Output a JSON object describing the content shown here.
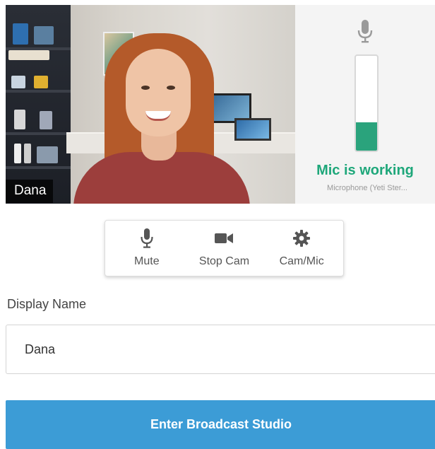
{
  "camera": {
    "name_tag": "Dana"
  },
  "mic": {
    "status": "Mic is working",
    "device": "Microphone (Yeti Ster...",
    "level": 0.3,
    "status_color": "#1ea77a"
  },
  "controls": [
    {
      "label": "Mute",
      "icon": "microphone-icon"
    },
    {
      "label": "Stop Cam",
      "icon": "video-camera-icon"
    },
    {
      "label": "Cam/Mic",
      "icon": "gear-icon"
    }
  ],
  "form": {
    "display_name_label": "Display Name",
    "display_name_value": "Dana"
  },
  "enter_button": {
    "label": "Enter Broadcast Studio",
    "color": "#3c9cd6"
  }
}
